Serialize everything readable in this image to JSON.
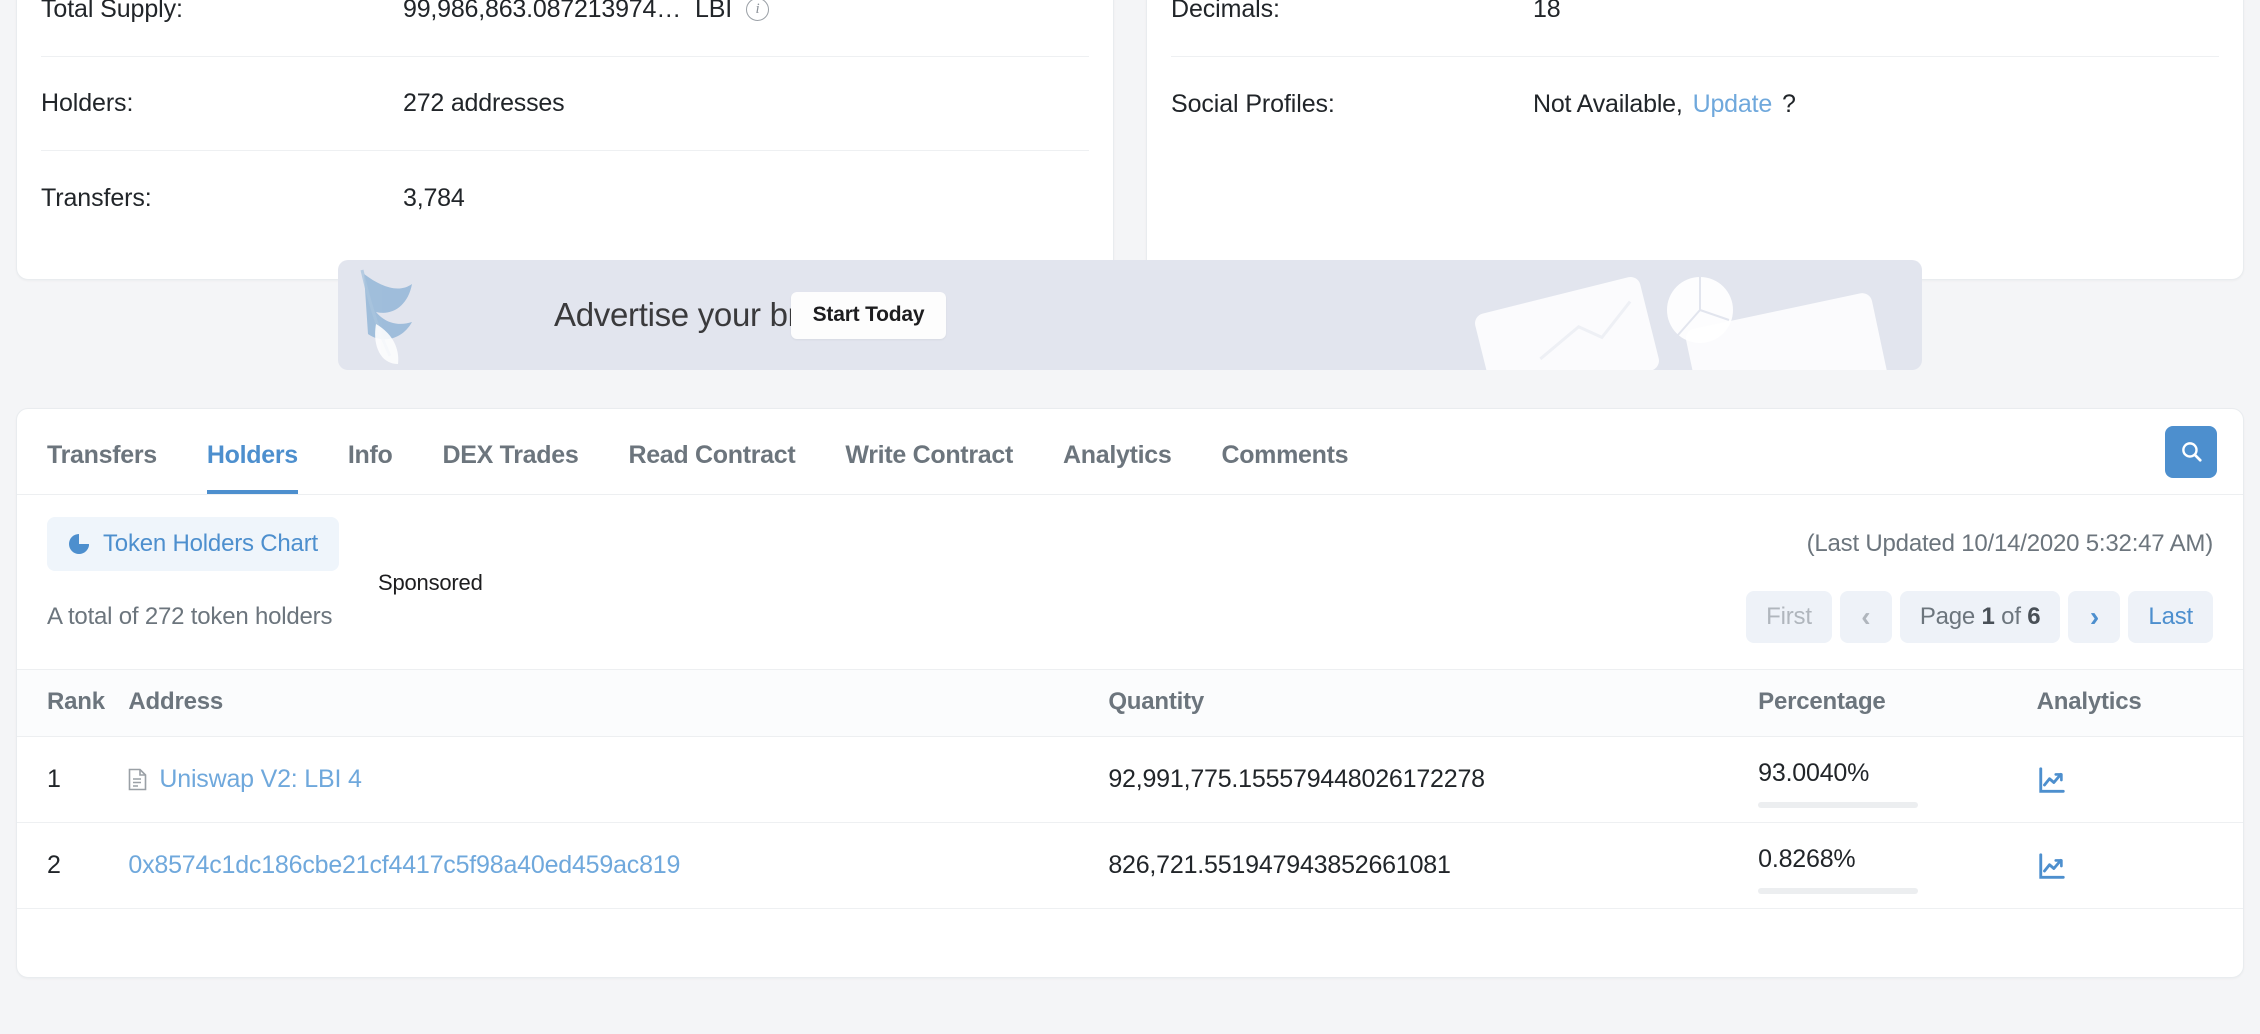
{
  "token_info": {
    "left": [
      {
        "label": "Total Supply:",
        "value": "99,986,863.087213974…",
        "symbol": "LBI",
        "has_info_icon": true
      },
      {
        "label": "Holders:",
        "value": "272 addresses",
        "symbol": "",
        "has_info_icon": false
      },
      {
        "label": "Transfers:",
        "value": "3,784",
        "symbol": "",
        "has_info_icon": false
      }
    ],
    "right": [
      {
        "label": "Decimals:",
        "value": "18"
      },
      {
        "label": "Social Profiles:",
        "value_prefix": "Not Available,",
        "link_text": "Update",
        "value_suffix": "?"
      }
    ]
  },
  "sponsor": {
    "tag": "Sponsored",
    "headline": "Advertise your brand here!",
    "cta": "Start Today"
  },
  "tabs": [
    {
      "label": "Transfers",
      "active": false
    },
    {
      "label": "Holders",
      "active": true
    },
    {
      "label": "Info",
      "active": false
    },
    {
      "label": "DEX Trades",
      "active": false
    },
    {
      "label": "Read Contract",
      "active": false
    },
    {
      "label": "Write Contract",
      "active": false
    },
    {
      "label": "Analytics",
      "active": false
    },
    {
      "label": "Comments",
      "active": false
    }
  ],
  "toolbar": {
    "chart_button": "Token Holders Chart",
    "last_updated": "(Last Updated 10/14/2020 5:32:47 AM)",
    "search_icon": "search-icon"
  },
  "listing": {
    "total_text": "A total of 272 token holders",
    "pagination": {
      "first": "First",
      "prev": "‹",
      "page_label_prefix": "Page",
      "page_current": "1",
      "page_label_mid": "of",
      "page_total": "6",
      "next": "›",
      "last": "Last"
    }
  },
  "table": {
    "headers": [
      "Rank",
      "Address",
      "Quantity",
      "Percentage",
      "Analytics"
    ],
    "rows": [
      {
        "rank": "1",
        "address": "Uniswap V2: LBI 4",
        "has_contract_icon": true,
        "quantity": "92,991,775.155579448026172278",
        "percentage": "93.0040%",
        "percentage_value": 93.004
      },
      {
        "rank": "2",
        "address": "0x8574c1dc186cbe21cf4417c5f98a40ed459ac819",
        "has_contract_icon": false,
        "quantity": "826,721.551947943852661081",
        "percentage": "0.8268%",
        "percentage_value": 0.8268
      }
    ]
  },
  "colors": {
    "accent": "#4d8fce",
    "link": "#6fa8dc",
    "muted": "#6c757d",
    "page_bg": "#f4f5f7",
    "banner_bg": "#e2e5ee"
  }
}
